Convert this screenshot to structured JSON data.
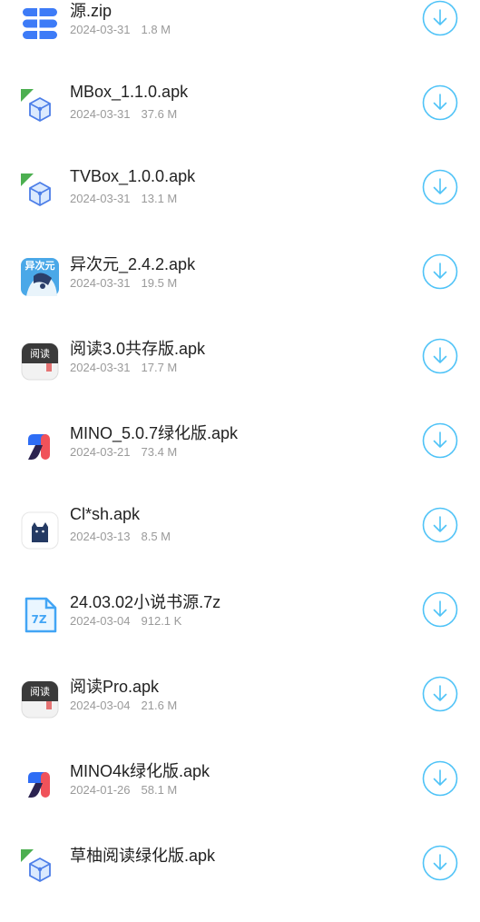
{
  "accent_color": "#4fc3f7",
  "files": [
    {
      "name": "源.zip",
      "date": "2024-03-31",
      "size": "1.8 M",
      "icon": "database-zip-icon"
    },
    {
      "name": "MBox_1.1.0.apk",
      "date": "2024-03-31",
      "size": "37.6 M",
      "icon": "apk-box-icon"
    },
    {
      "name": "TVBox_1.0.0.apk",
      "date": "2024-03-31",
      "size": "13.1 M",
      "icon": "apk-box-icon"
    },
    {
      "name": "异次元_2.4.2.apk",
      "date": "2024-03-31",
      "size": "19.5 M",
      "icon": "yiciyuan-app-icon",
      "icon_text": "异次元"
    },
    {
      "name": "阅读3.0共存版.apk",
      "date": "2024-03-31",
      "size": "17.7 M",
      "icon": "yuedu-app-icon",
      "icon_text": "阅读"
    },
    {
      "name": "MINO_5.0.7绿化版.apk",
      "date": "2024-03-21",
      "size": "73.4 M",
      "icon": "mino-app-icon"
    },
    {
      "name": "Cl*sh.apk",
      "date": "2024-03-13",
      "size": "8.5 M",
      "icon": "cat-app-icon"
    },
    {
      "name": "24.03.02小说书源.7z",
      "date": "2024-03-04",
      "size": "912.1 K",
      "icon": "7z-file-icon",
      "icon_text": "7Z"
    },
    {
      "name": "阅读Pro.apk",
      "date": "2024-03-04",
      "size": "21.6 M",
      "icon": "yuedu-app-icon",
      "icon_text": "阅读"
    },
    {
      "name": "MINO4k绿化版.apk",
      "date": "2024-01-26",
      "size": "58.1 M",
      "icon": "mino-app-icon"
    },
    {
      "name": "草柚阅读绿化版.apk",
      "date": "",
      "size": "",
      "icon": "apk-box-icon"
    }
  ]
}
